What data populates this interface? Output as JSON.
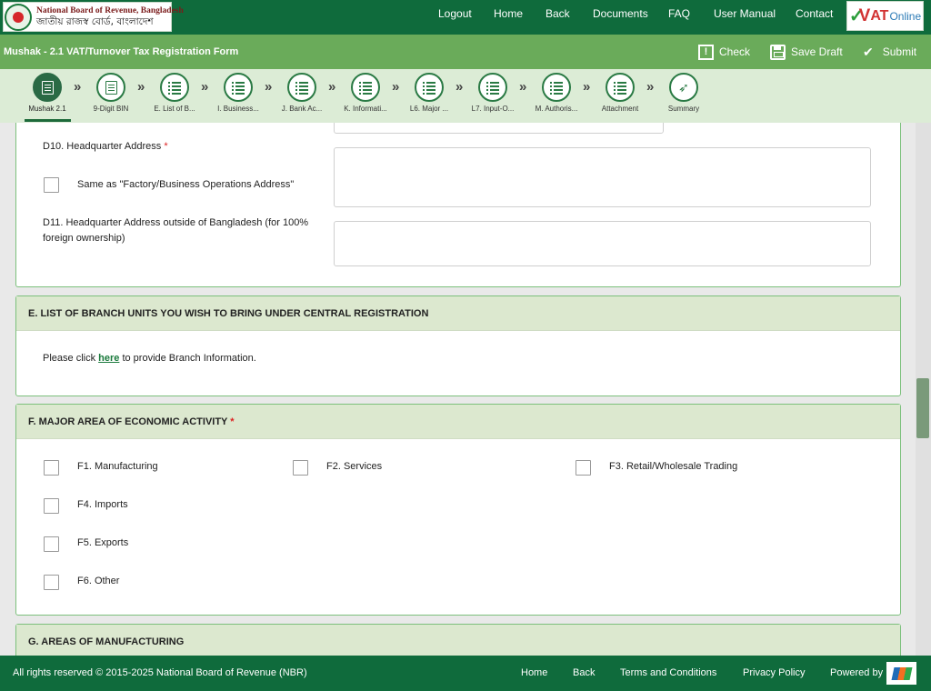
{
  "brand": {
    "name_en": "National Board of Revenue, Bangladesh",
    "name_bn": "জাতীয় রাজস্ব বোর্ড, বাংলাদেশ",
    "seal_icon": "nbr-seal-icon"
  },
  "topnav": {
    "logout": "Logout",
    "home": "Home",
    "back": "Back",
    "documents": "Documents",
    "faq": "FAQ",
    "user_manual": "User Manual",
    "contact": "Contact"
  },
  "vat_logo": {
    "v": "V",
    "at": "AT",
    "online": "Online"
  },
  "titlebar": {
    "title": "Mushak - 2.1 VAT/Turnover Tax Registration Form",
    "check": "Check",
    "save_draft": "Save Draft",
    "submit": "Submit"
  },
  "stepper": {
    "steps": [
      {
        "label": "Mushak 2.1",
        "icon": "form-icon",
        "active": true
      },
      {
        "label": "9-Digit BIN",
        "icon": "form-icon",
        "active": false
      },
      {
        "label": "E. List of B...",
        "icon": "list-icon",
        "active": false
      },
      {
        "label": "I. Business...",
        "icon": "list-icon",
        "active": false
      },
      {
        "label": "J. Bank Ac...",
        "icon": "list-icon",
        "active": false
      },
      {
        "label": "K. Informati...",
        "icon": "list-icon",
        "active": false
      },
      {
        "label": "L6. Major ...",
        "icon": "list-icon",
        "active": false
      },
      {
        "label": "L7. Input-O...",
        "icon": "list-icon",
        "active": false
      },
      {
        "label": "M. Authoris...",
        "icon": "list-icon",
        "active": false
      },
      {
        "label": "Attachment",
        "icon": "list-icon",
        "active": false
      },
      {
        "label": "Summary",
        "icon": "paper-plane-icon",
        "active": false
      }
    ]
  },
  "section_d": {
    "d10_label": "D10. Headquarter Address",
    "d10_required": "*",
    "same_as_label": "Same as \"Factory/Business Operations Address\"",
    "d11_label": "D11. Headquarter Address outside of Bangladesh (for 100% foreign ownership)",
    "d10_value": "",
    "d11_value": ""
  },
  "section_e": {
    "title": "E. LIST OF BRANCH UNITS YOU WISH TO BRING UNDER CENTRAL REGISTRATION",
    "text_before": "Please click ",
    "link": "here",
    "text_after": " to provide Branch Information."
  },
  "section_f": {
    "title": "F. MAJOR AREA OF ECONOMIC ACTIVITY",
    "required": "*",
    "options": [
      {
        "label": "F1. Manufacturing",
        "checked": false
      },
      {
        "label": "F2. Services",
        "checked": false
      },
      {
        "label": "F3. Retail/Wholesale Trading",
        "checked": false
      },
      {
        "label": "F4. Imports",
        "checked": false
      },
      {
        "label": "F5. Exports",
        "checked": false
      },
      {
        "label": "F6. Other",
        "checked": false
      }
    ]
  },
  "section_g": {
    "title": "G. AREAS OF MANUFACTURING"
  },
  "footer": {
    "copyright": "All rights reserved © 2015-2025 National Board of Revenue (NBR)",
    "home": "Home",
    "back": "Back",
    "terms": "Terms and Conditions",
    "privacy": "Privacy Policy",
    "powered_by": "Powered by"
  },
  "colors": {
    "header_green": "#0f6b3c",
    "titlebar_green": "#6aab5a",
    "stepper_bg": "#dcecd6",
    "card_header_bg": "#dce8cf",
    "card_border": "#7cc07c",
    "required_red": "#dd2222"
  }
}
